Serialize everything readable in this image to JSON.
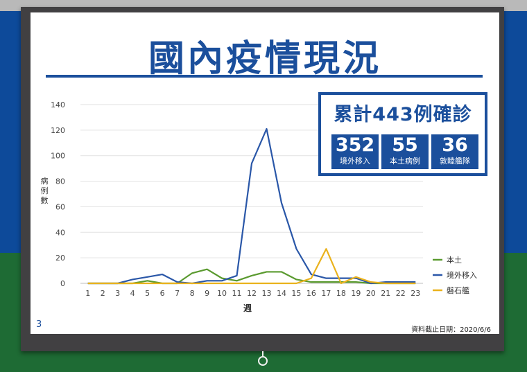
{
  "slide": {
    "title": "國內疫情現況",
    "page_number": "3",
    "footnote": "資料截止日期：2020/6/6"
  },
  "summary": {
    "title": "累計443例確診",
    "stats": [
      {
        "value": "352",
        "label": "境外移入"
      },
      {
        "value": "55",
        "label": "本土病例"
      },
      {
        "value": "36",
        "label": "敦睦艦隊"
      }
    ]
  },
  "colors": {
    "brand": "#1b4f9c",
    "local": "#5a9a2f",
    "imported": "#2a57a8",
    "fleet": "#eab21c"
  },
  "chart_data": {
    "type": "line",
    "x": [
      1,
      2,
      3,
      4,
      5,
      6,
      7,
      8,
      9,
      10,
      11,
      12,
      13,
      14,
      15,
      16,
      17,
      18,
      19,
      20,
      21,
      22,
      23
    ],
    "xlabel": "週",
    "ylabel": "病例數",
    "ylim": [
      0,
      140
    ],
    "yticks": [
      0,
      20,
      40,
      60,
      80,
      100,
      120,
      140
    ],
    "grid": true,
    "legend_position": "right",
    "series": [
      {
        "name": "本土",
        "color": "#5a9a2f",
        "values": [
          0,
          0,
          0,
          0,
          2,
          0,
          0,
          8,
          11,
          4,
          2,
          6,
          9,
          9,
          3,
          1,
          1,
          1,
          1,
          0,
          0,
          0,
          0
        ]
      },
      {
        "name": "境外移入",
        "color": "#2a57a8",
        "values": [
          0,
          0,
          0,
          3,
          5,
          7,
          1,
          0,
          2,
          2,
          6,
          94,
          121,
          63,
          27,
          7,
          4,
          4,
          4,
          0,
          1,
          1,
          1
        ]
      },
      {
        "name": "磐石艦",
        "color": "#eab21c",
        "values": [
          0,
          0,
          0,
          0,
          0,
          0,
          0,
          0,
          0,
          0,
          0,
          0,
          0,
          0,
          0,
          4,
          27,
          0,
          5,
          1,
          0,
          0,
          0
        ]
      }
    ]
  }
}
